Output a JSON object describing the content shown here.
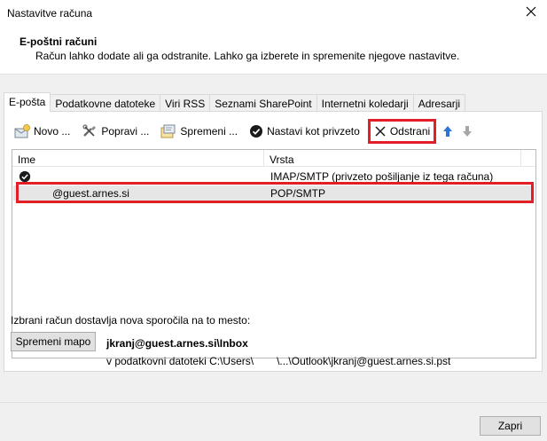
{
  "window": {
    "title": "Nastavitve računa"
  },
  "header": {
    "title": "E-poštni računi",
    "description": "Račun lahko dodate ali ga odstranite. Lahko ga izberete in spremenite njegove nastavitve."
  },
  "tabs": [
    {
      "label": "E-pošta",
      "active": true
    },
    {
      "label": "Podatkovne datoteke",
      "active": false
    },
    {
      "label": "Viri RSS",
      "active": false
    },
    {
      "label": "Seznami SharePoint",
      "active": false
    },
    {
      "label": "Internetni koledarji",
      "active": false
    },
    {
      "label": "Adresarji",
      "active": false
    }
  ],
  "toolbar": {
    "new_label": "Novo ...",
    "repair_label": "Popravi ...",
    "change_label": "Spremeni ...",
    "set_default_label": "Nastavi kot privzeto",
    "remove_label": "Odstrani"
  },
  "list": {
    "columns": [
      "Ime",
      "Vrsta"
    ],
    "rows": [
      {
        "name": "",
        "type": "IMAP/SMTP (privzeto pošiljanje iz tega računa)",
        "default": true
      },
      {
        "name": "@guest.arnes.si",
        "type": "POP/SMTP",
        "default": false,
        "selected": true
      }
    ]
  },
  "delivery": {
    "label": "Izbrani račun dostavlja nova sporočila na to mesto:",
    "change_folder_label": "Spremeni mapo",
    "folder_path": "jkranj@guest.arnes.si\\Inbox",
    "data_file_prefix": "v podatkovni datoteki C:\\Users\\",
    "data_file_suffix": "\\...\\Outlook\\jkranj@guest.arnes.si.pst"
  },
  "footer": {
    "close_label": "Zapri"
  },
  "colors": {
    "highlight": "#e21f26",
    "up_arrow": "#2e74d6",
    "down_arrow": "#a6a6a6"
  }
}
